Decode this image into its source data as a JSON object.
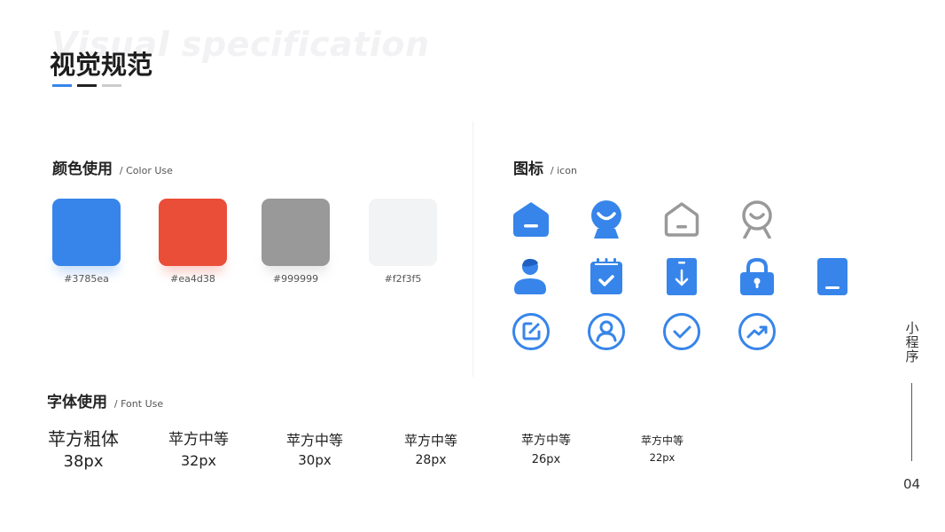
{
  "header": {
    "watermark": "Visual specification",
    "title": "视觉规范",
    "bar_colors": [
      "#3785ea",
      "#222222",
      "#cccccc"
    ]
  },
  "color_section": {
    "title": "颜色使用",
    "subtitle": "/ Color Use",
    "swatches": [
      {
        "label": "#3785ea",
        "color": "#3785ea"
      },
      {
        "label": "#ea4d38",
        "color": "#ea4d38"
      },
      {
        "label": "#999999",
        "color": "#999999"
      },
      {
        "label": "#f2f3f5",
        "color": "#f2f3f5"
      }
    ]
  },
  "icon_section": {
    "title": "图标",
    "subtitle": "/ icon",
    "accent": "#3785ea",
    "muted": "#999999",
    "icons": [
      "home-filled-icon",
      "webcam-filled-icon",
      "home-outline-icon",
      "webcam-outline-icon",
      "user-filled-icon",
      "calendar-check-icon",
      "phone-download-icon",
      "lock-icon",
      "tablet-icon",
      "edit-circle-icon",
      "user-circle-icon",
      "check-circle-icon",
      "trend-circle-icon"
    ]
  },
  "font_section": {
    "title": "字体使用",
    "subtitle": "/ Font Use",
    "samples": [
      {
        "name": "苹方粗体",
        "size": "38px"
      },
      {
        "name": "苹方中等",
        "size": "32px"
      },
      {
        "name": "苹方中等",
        "size": "30px"
      },
      {
        "name": "苹方中等",
        "size": "28px"
      },
      {
        "name": "苹方中等",
        "size": "26px"
      },
      {
        "name": "苹方中等",
        "size": "22px"
      }
    ]
  },
  "side": {
    "label": "小程序",
    "page_number": "04"
  }
}
